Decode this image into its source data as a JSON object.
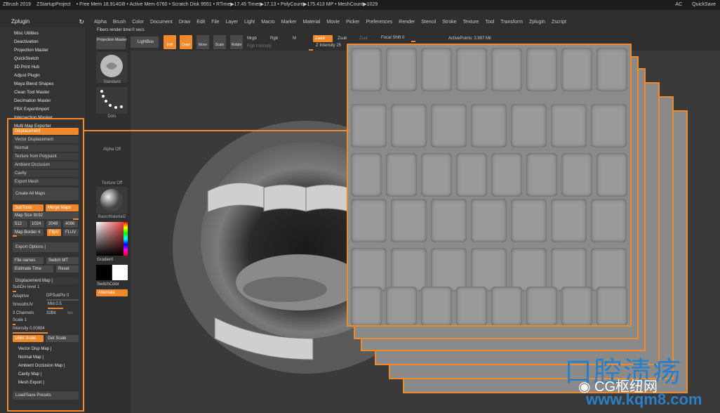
{
  "titlebar": {
    "app": "ZBrush 2019",
    "project": "ZStartupProject",
    "stats": "• Free Mem 18.914GB • Active Mem 6760 • Scratch Disk 9551 • RTime▶17.45 Timer▶17.13 • PolyCount▶175.413 MP • MeshCount▶1029",
    "ac": "AC",
    "quicksave": "QuickSave"
  },
  "menus": [
    "Alpha",
    "Brush",
    "Color",
    "Document",
    "Draw",
    "Edit",
    "File",
    "Layer",
    "Light",
    "Macro",
    "Marker",
    "Material",
    "Movie",
    "Picker",
    "Preferences",
    "Render",
    "Stencil",
    "Stroke",
    "Texture",
    "Tool",
    "Transform",
    "Zplugin",
    "Zscript"
  ],
  "render_time": "Fibers render time:0 secs",
  "plugin": {
    "title": "Zplugin",
    "items": [
      "Misc Utilities",
      "Deactivation",
      "Projection Master",
      "QuickSketch",
      "3D Print Hub",
      "Adjust Plugin",
      "Maya Blend Shapes",
      "Clean Tool Master",
      "Decimation Master",
      "FBX ExportImport",
      "Intersection Masker",
      "Multi Map Exporter"
    ],
    "map_types": [
      "Displacement",
      "Vector Displacement",
      "Normal",
      "Texture from Polypaint",
      "Ambient Occlusion",
      "Cavity",
      "Export Mesh"
    ],
    "create_all": "Create All Maps",
    "subtools": "SubTools",
    "merge_maps": "Merge Maps",
    "map_size_label": "Map Size",
    "map_size_value": "8192",
    "sizes": [
      "512",
      "1024",
      "2048",
      "4096"
    ],
    "map_border_label": "Map Border",
    "map_border_value": "4",
    "flipv": "FlipV",
    "fluv": "FLUV",
    "export_options": "Export Options",
    "file_names": "File names",
    "switch_mt": "Switch MT",
    "estimate_time": "Estimate Time",
    "reset": "Reset",
    "displacement_map": "Displacement Map",
    "subdiv_label": "SubDiv level",
    "subdiv_value": "1",
    "adaptive": "Adaptive",
    "dpsubpix_label": "DPSubPix",
    "dpsubpix_value": "0",
    "smoothuv": "SmoothUV",
    "mid_label": "Mid",
    "mid_value": "0.5",
    "channels": "3 Channels",
    "bits": "32Bit",
    "tex": "tex",
    "scale_label": "Scale",
    "scale_value": "1",
    "intensity_label": "Intensity",
    "intensity_value": "0.00894",
    "scale16": "16Bit Scale",
    "get_scale": "Get Scale",
    "sections": [
      "Vector Disp Map",
      "Normal Map",
      "Ambient Occlusion Map",
      "Cavity Map",
      "Mesh Export"
    ],
    "load_save": "Load/Save Presets"
  },
  "toolpanel": {
    "projection_master": "Projection Master",
    "lightbox": "LightBox",
    "brush": "Standard",
    "stroke": "Dots",
    "alpha": "Alpha Off",
    "texture": "Texture Off",
    "material": "BasicMaterial2",
    "gradient": "Gradient",
    "switch_color": "SwitchColor",
    "alternate": "Alternate"
  },
  "topbar": {
    "edit": "Edit",
    "draw": "Draw",
    "move": "Move",
    "scale": "Scale",
    "rotate": "Rotate",
    "mrgb": "Mrgb",
    "rgb": "Rgb",
    "m": "M",
    "zadd": "Zadd",
    "zsub": "Zsub",
    "zcut": "Zcut",
    "focal_shift": "Focal Shift 0",
    "active_points": "ActivePoints: 3.997 Mil",
    "rgb_intensity": "Rgb Intensity",
    "z_intensity": "Z Intensity 25"
  },
  "watermark": {
    "text": "口腔渍疡",
    "brand": "CG枢纽网",
    "url": "www.kqm8.com"
  },
  "colors": {
    "accent": "#f0892b",
    "brand_blue": "#2a7fc6"
  }
}
